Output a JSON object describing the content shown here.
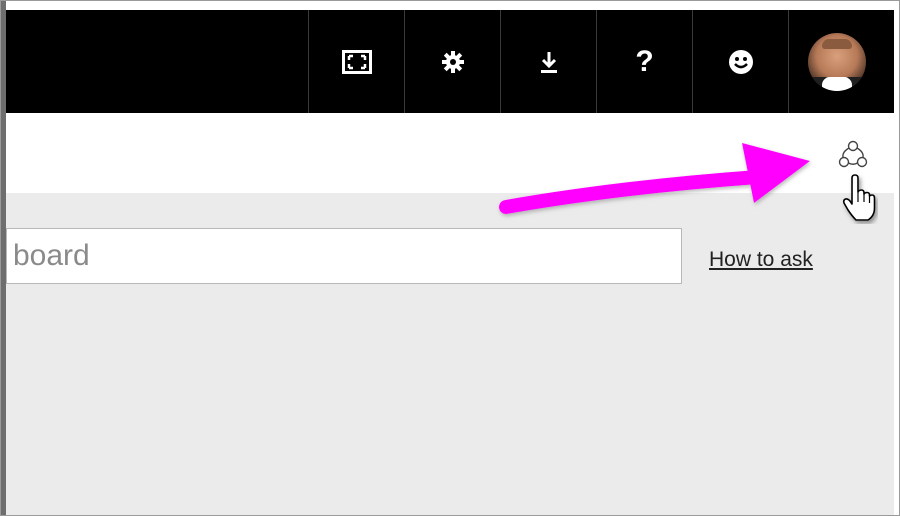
{
  "topbar": {
    "buttons": [
      {
        "name": "fullscreen",
        "icon": "fullscreen-icon"
      },
      {
        "name": "settings",
        "icon": "gear-icon"
      },
      {
        "name": "download",
        "icon": "download-icon"
      },
      {
        "name": "help",
        "label": "?",
        "icon": "question-icon"
      },
      {
        "name": "feedback",
        "icon": "smiley-icon"
      },
      {
        "name": "account",
        "icon": "user-avatar"
      }
    ],
    "background": "#000000"
  },
  "toolbar": {
    "share_icon": "share-icon"
  },
  "qa": {
    "input_text": "board",
    "how_to_ask_label": "How to ask"
  },
  "annotation": {
    "arrow_color": "#ff00ff",
    "cursor_icon": "hand-pointer-cursor"
  },
  "colors": {
    "content_background": "#ebebeb",
    "accent_arrow": "#ff00ff"
  }
}
